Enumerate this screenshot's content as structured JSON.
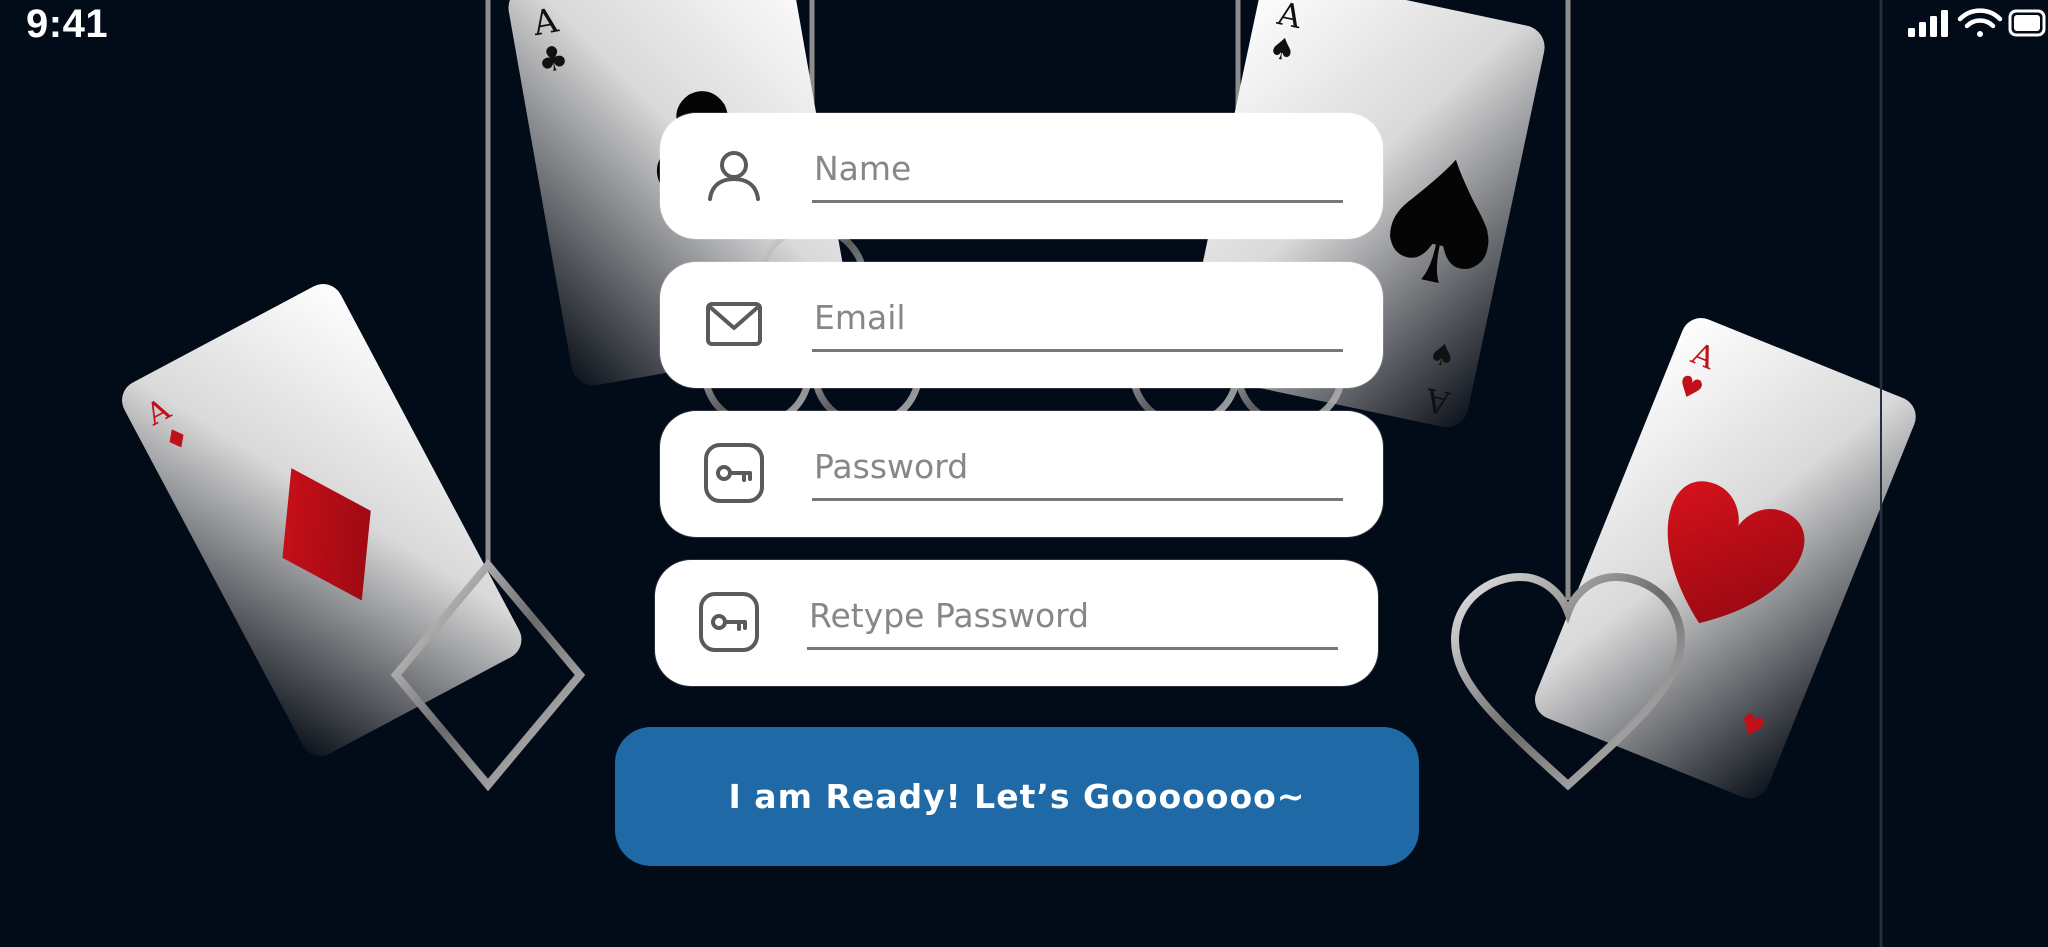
{
  "status_bar": {
    "time": "9:41",
    "icons": [
      "cellular-signal-icon",
      "wifi-icon",
      "battery-icon"
    ]
  },
  "form": {
    "name_placeholder": "Name",
    "email_placeholder": "Email",
    "password_placeholder": "Password",
    "retype_password_placeholder": "Retype Password",
    "submit_label": "I am Ready! Let’s Gooooooo~"
  },
  "background": {
    "cards": [
      {
        "rank": "A",
        "suit": "clubs"
      },
      {
        "rank": "A",
        "suit": "spades"
      },
      {
        "rank": "A",
        "suit": "diamonds"
      },
      {
        "rank": "A",
        "suit": "hearts"
      }
    ],
    "colors": {
      "background": "#020b18",
      "button": "#1f6aa6",
      "red_suit": "#c0101a"
    }
  }
}
